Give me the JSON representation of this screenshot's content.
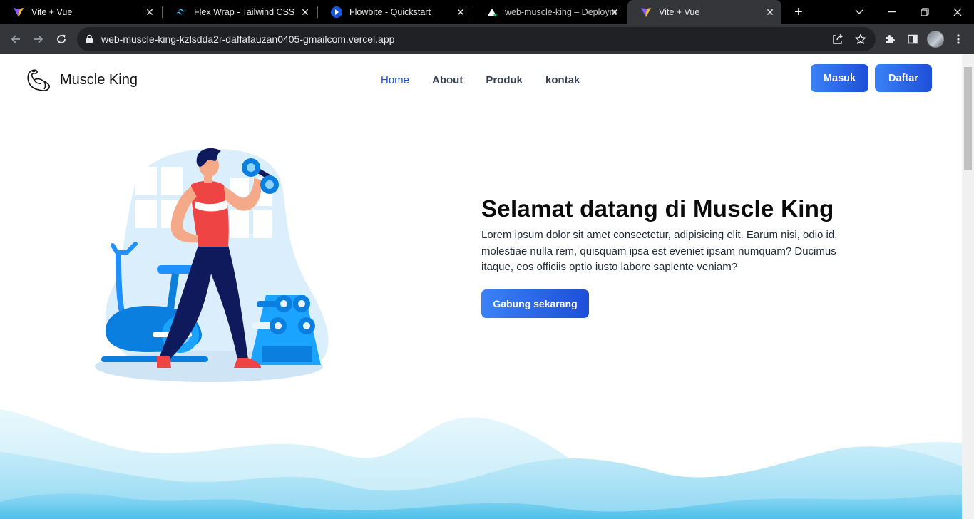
{
  "browser": {
    "tabs": [
      {
        "title": "Vite + Vue",
        "icon": "vite-icon",
        "active": false
      },
      {
        "title": "Flex Wrap - Tailwind CSS",
        "icon": "tailwind-icon",
        "active": false
      },
      {
        "title": "Flowbite - Quickstart",
        "icon": "flowbite-icon",
        "active": false
      },
      {
        "title": "web-muscle-king – Deploym",
        "icon": "vercel-icon",
        "active": false
      },
      {
        "title": "Vite + Vue",
        "icon": "vite-icon",
        "active": true
      }
    ],
    "url": "web-muscle-king-kzlsdda2r-daffafauzan0405-gmailcom.vercel.app"
  },
  "site": {
    "brand": "Muscle King",
    "nav": [
      {
        "label": "Home",
        "active": true
      },
      {
        "label": "About",
        "active": false
      },
      {
        "label": "Produk",
        "active": false
      },
      {
        "label": "kontak",
        "active": false
      }
    ],
    "login_label": "Masuk",
    "register_label": "Daftar",
    "hero": {
      "title": "Selamat datang di Muscle King",
      "text": "Lorem ipsum dolor sit amet consectetur, adipisicing elit. Earum nisi, odio id, molestiae nulla rem, quisquam ipsa est eveniet ipsam numquam? Ducimus itaque, eos officiis optio iusto labore sapiente veniam?",
      "cta_label": "Gabung sekarang"
    }
  },
  "colors": {
    "accent": "#1d4ed8",
    "accent_light": "#3b82f6",
    "tab_bar": "#000000",
    "toolbar": "#35363a"
  }
}
